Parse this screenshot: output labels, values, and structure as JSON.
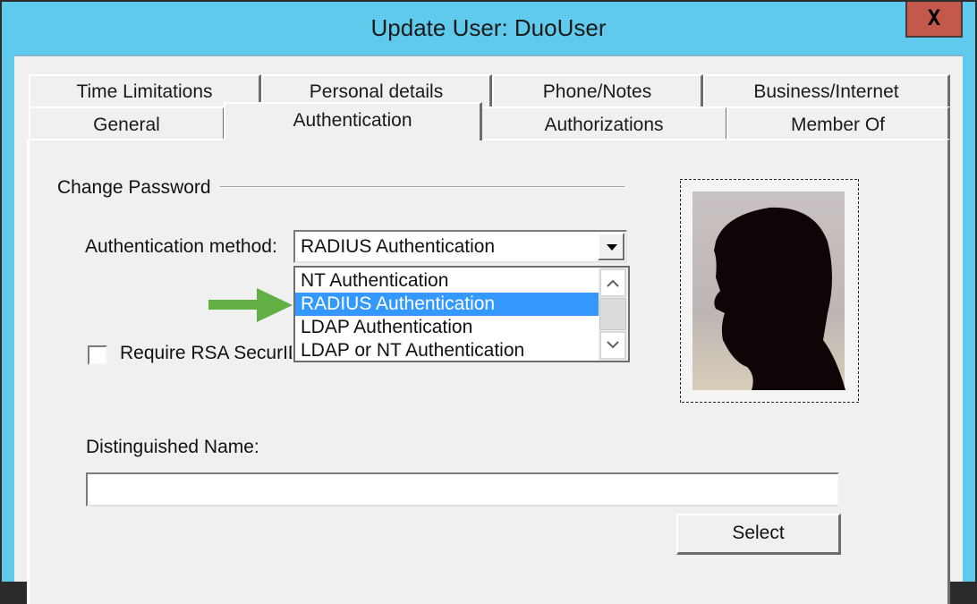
{
  "window": {
    "title": "Update User: DuoUser",
    "close_label": "X",
    "colors": {
      "titlebar": "#5fcaeb",
      "close": "#c5584c",
      "highlight": "#3399ff",
      "arrow": "#62b043"
    }
  },
  "tabs": {
    "row1": [
      {
        "label": "Time Limitations"
      },
      {
        "label": "Personal details"
      },
      {
        "label": "Phone/Notes"
      },
      {
        "label": "Business/Internet"
      }
    ],
    "row2": [
      {
        "label": "General"
      },
      {
        "label": "Authentication",
        "selected": true
      },
      {
        "label": "Authorizations"
      },
      {
        "label": "Member Of"
      }
    ]
  },
  "authentication": {
    "group_label": "Change Password",
    "method_label": "Authentication method:",
    "method_value": "RADIUS Authentication",
    "method_options": [
      {
        "label": "NT Authentication"
      },
      {
        "label": "RADIUS Authentication",
        "highlighted": true
      },
      {
        "label": "LDAP Authentication"
      },
      {
        "label": "LDAP or NT Authentication"
      }
    ],
    "rsa_checkbox_label": "Require RSA SecurID",
    "rsa_checked": false,
    "dn_label": "Distinguished Name:",
    "dn_value": "",
    "select_button": "Select",
    "photo_icon": "user-silhouette-photo",
    "annotation_icon": "green-arrow-pointer"
  }
}
